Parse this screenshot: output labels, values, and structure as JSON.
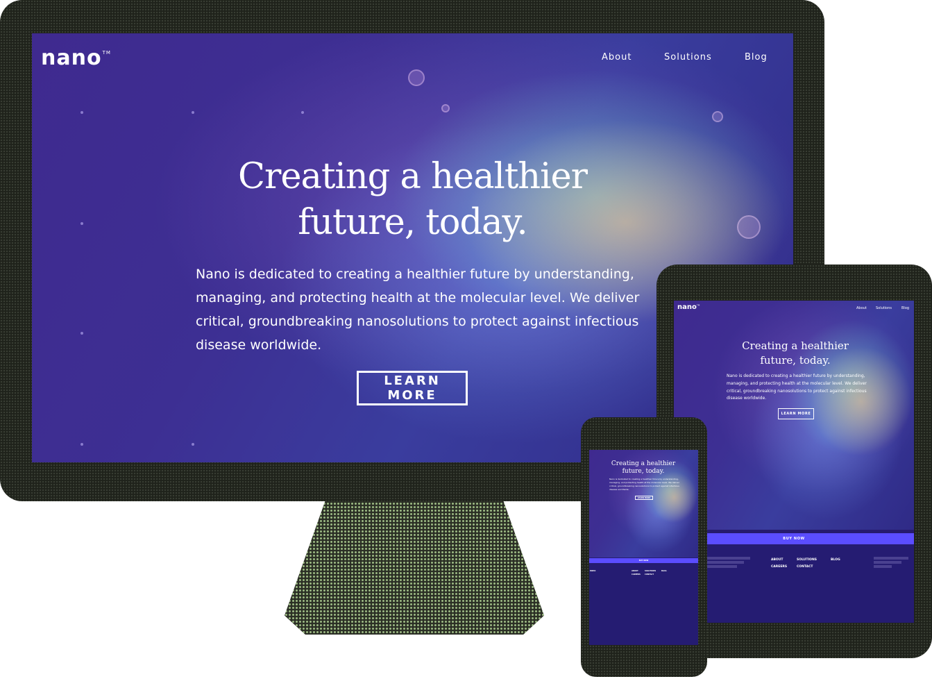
{
  "brand": {
    "logo_text": "nano",
    "trademark": "TM"
  },
  "nav": {
    "items": [
      "About",
      "Solutions",
      "Blog"
    ]
  },
  "hero": {
    "headline_line1": "Creating a healthier",
    "headline_line2": "future, today.",
    "description": "Nano is dedicated to creating a healthier future by understanding, managing, and protecting health at the molecular level. We deliver critical, groundbreaking nanosolutions to protect against infectious disease worldwide.",
    "cta_label": "LEARN MORE"
  },
  "buy_bar": {
    "label": "BUY NOW"
  },
  "footer": {
    "links": [
      "ABOUT",
      "SOLUTIONS",
      "BLOG",
      "CAREERS",
      "CONTACT"
    ]
  },
  "colors": {
    "device_frame": "#1f221b",
    "stand_dots": "#9fbe86",
    "hero_purple": "#3f2a8f",
    "buy_bar": "#5b4dff",
    "footer_bg": "#251c72"
  }
}
